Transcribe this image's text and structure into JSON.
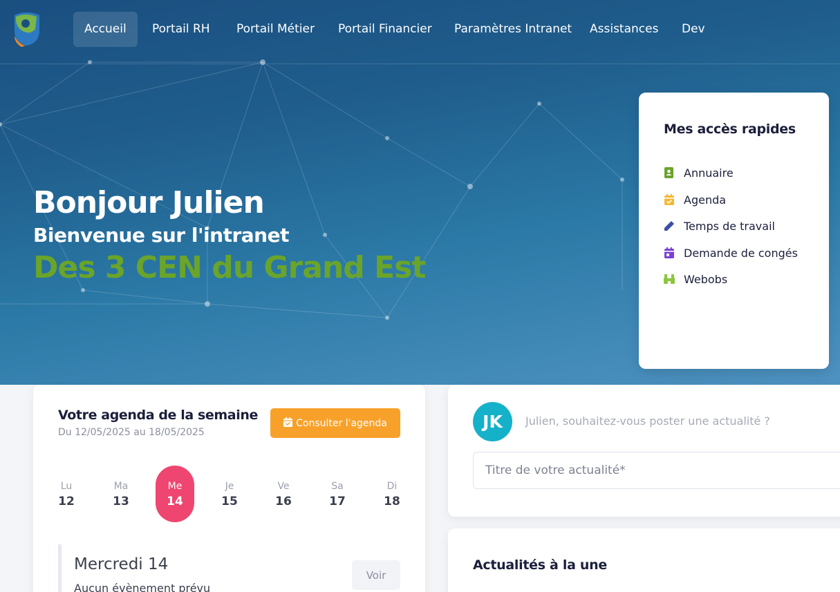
{
  "nav": {
    "items": [
      {
        "label": "Accueil",
        "active": true
      },
      {
        "label": "Portail RH"
      },
      {
        "label": "Portail Métier"
      },
      {
        "label": "Portail Financier"
      },
      {
        "label": "Paramètres Intranet"
      },
      {
        "label": "Assistances"
      },
      {
        "label": "Dev"
      }
    ]
  },
  "hero": {
    "greeting": "Bonjour Julien",
    "welcome": "Bienvenue sur l'intranet",
    "org": "Des 3 CEN du Grand Est",
    "org_color": "#6aa42a"
  },
  "quick_access": {
    "title": "Mes accès rapides",
    "items": [
      {
        "label": "Annuaire",
        "icon": "contact-book-icon",
        "color": "#6aa42a"
      },
      {
        "label": "Agenda",
        "icon": "calendar-check-icon",
        "color": "#f5b82e"
      },
      {
        "label": "Temps de travail",
        "icon": "pencil-icon",
        "color": "#3d4fa5"
      },
      {
        "label": "Demande de congés",
        "icon": "calendar-day-icon",
        "color": "#7b3fd6"
      },
      {
        "label": "Webobs",
        "icon": "binoculars-icon",
        "color": "#8cc63f"
      }
    ]
  },
  "agenda": {
    "title": "Votre agenda de la semaine",
    "range": "Du 12/05/2025 au 18/05/2025",
    "button": "Consulter l'agenda",
    "button_color": "#f8a12a",
    "days": [
      {
        "name": "Lu",
        "num": "12"
      },
      {
        "name": "Ma",
        "num": "13"
      },
      {
        "name": "Me",
        "num": "14",
        "selected": true
      },
      {
        "name": "Je",
        "num": "15"
      },
      {
        "name": "Ve",
        "num": "16"
      },
      {
        "name": "Sa",
        "num": "17"
      },
      {
        "name": "Di",
        "num": "18"
      }
    ],
    "selected_color": "#ee4670",
    "today_title": "Mercredi 14",
    "today_text": "Aucun évènement prévu",
    "view_button": "Voir"
  },
  "post": {
    "avatar_initials": "JK",
    "prompt": "Julien, souhaitez-vous poster une actualité ?",
    "title_placeholder": "Titre de votre actualité*"
  },
  "news": {
    "title": "Actualités à la une"
  }
}
